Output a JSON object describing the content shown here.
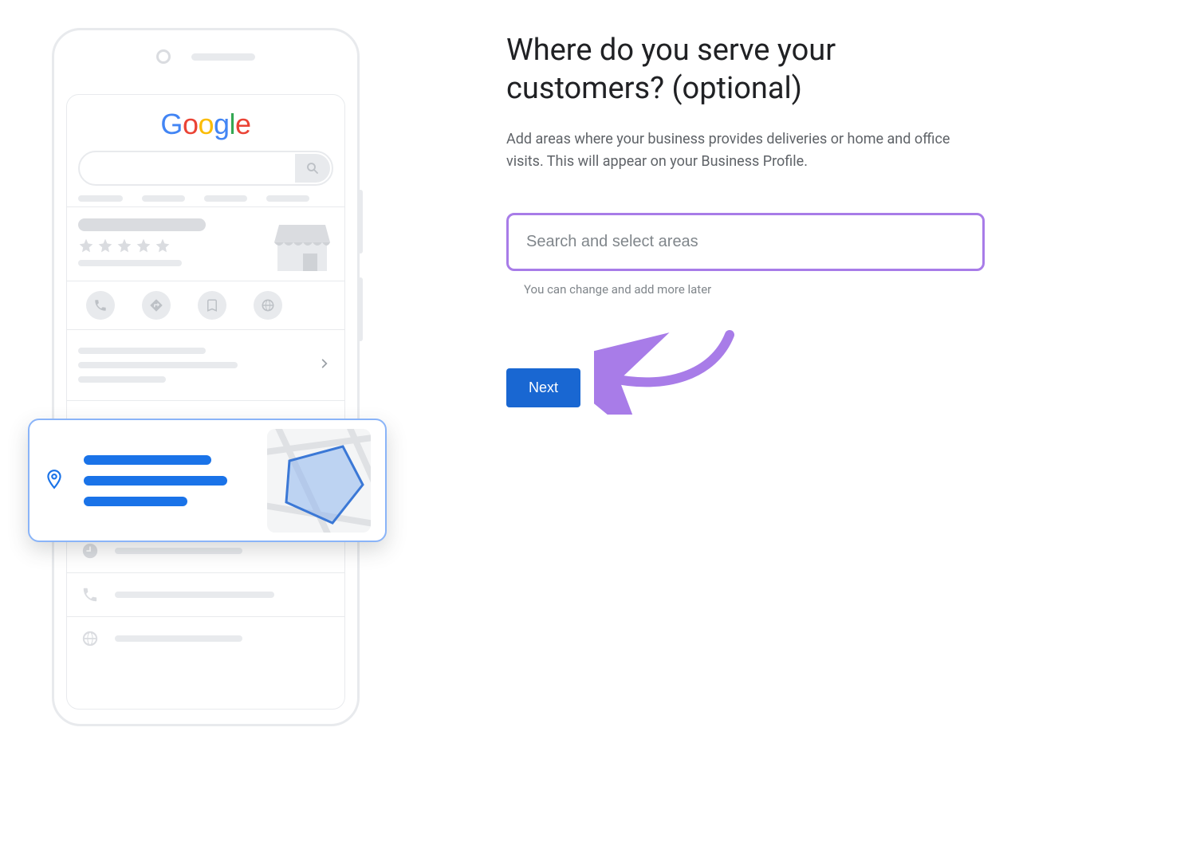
{
  "form": {
    "heading": "Where do you serve your customers? (optional)",
    "description": "Add areas where your business provides deliveries or home and office visits. This will appear on your Business Profile.",
    "search_placeholder": "Search and select areas",
    "hint": "You can change and add more later",
    "next_label": "Next"
  },
  "phone": {
    "logo_letters": [
      "G",
      "o",
      "o",
      "g",
      "l",
      "e"
    ]
  },
  "annotation": {
    "purpose": "arrow pointing to Next button",
    "color": "#a87ce8"
  }
}
